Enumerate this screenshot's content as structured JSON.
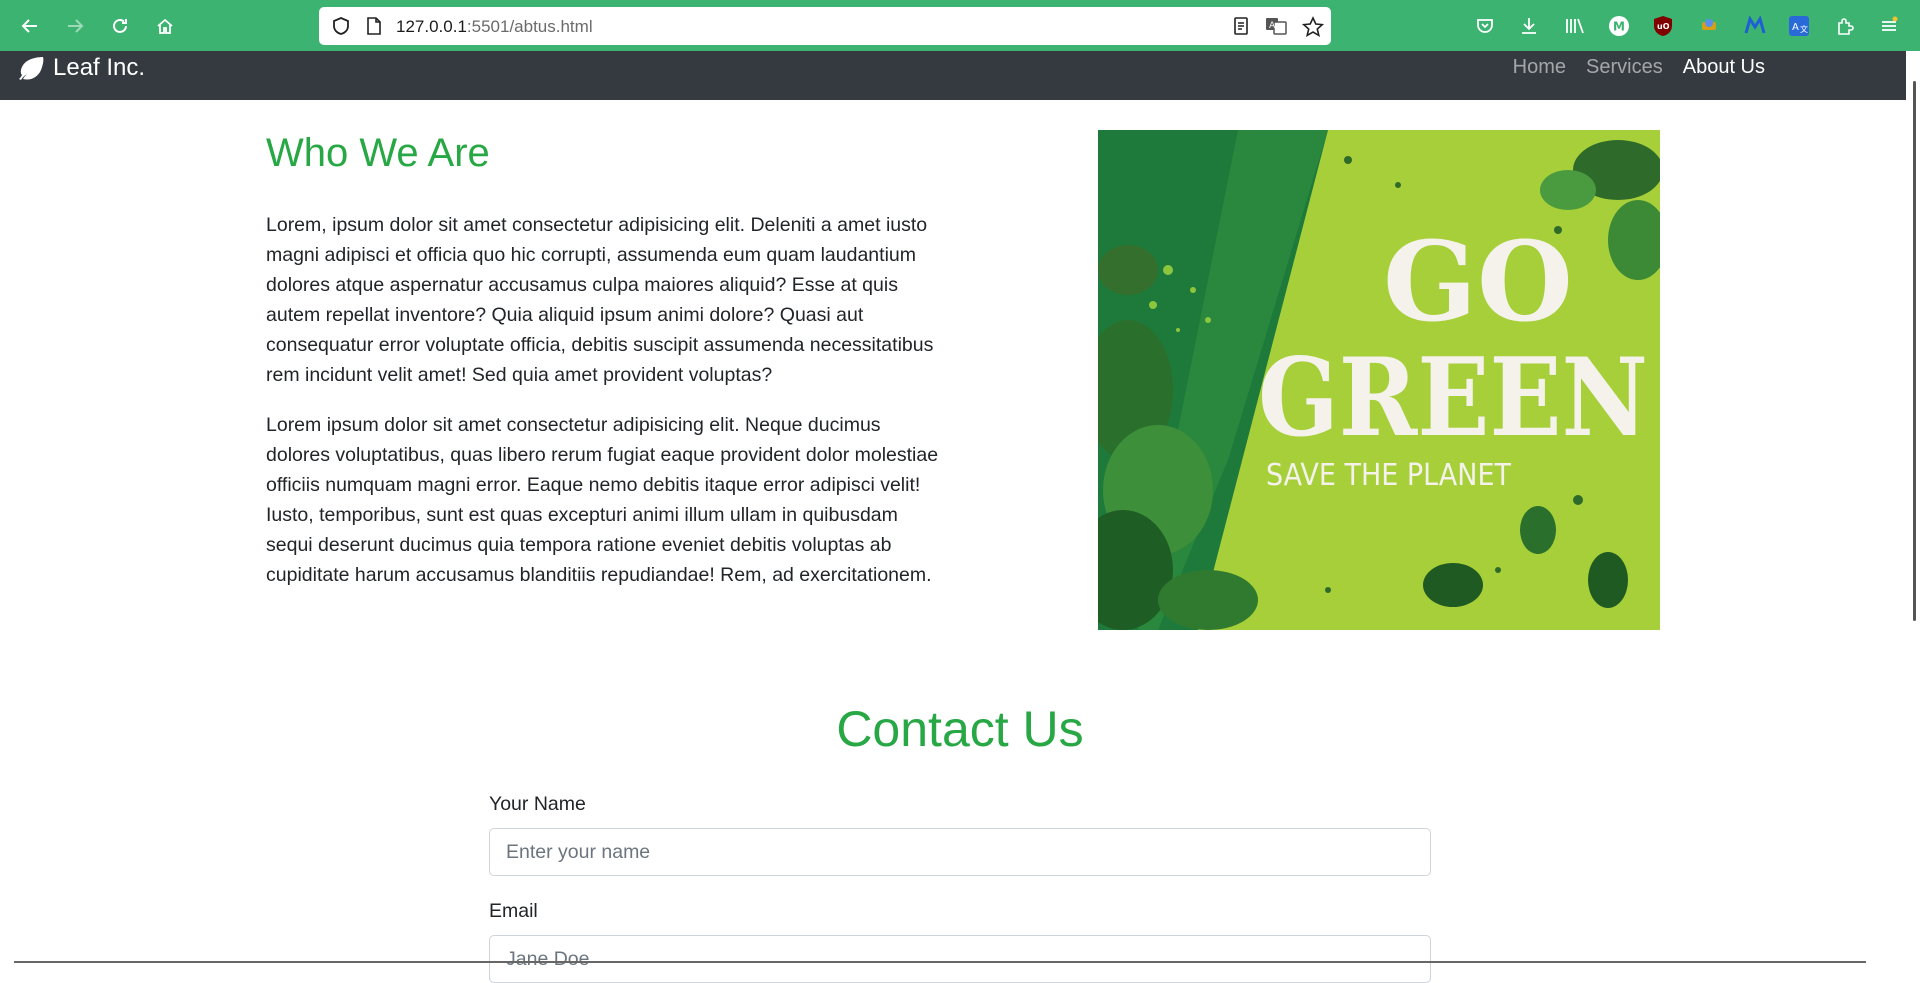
{
  "browser": {
    "url_host": "127.0.0.1",
    "url_rest": ":5501/abtus.html",
    "accent_color": "#3cb371",
    "icons": [
      "back-icon",
      "forward-icon",
      "reload-icon",
      "home-icon",
      "shield-icon",
      "page-icon",
      "reader-view-icon",
      "translate-icon",
      "bookmark-star-icon",
      "pocket-icon",
      "download-icon",
      "library-icon",
      "m-extension-icon",
      "ublock-icon",
      "extension-icon",
      "malwarebytes-icon",
      "translator-icon",
      "extensions-icon",
      "menu-icon"
    ]
  },
  "navbar": {
    "brand": "Leaf Inc.",
    "links": [
      {
        "label": "Home",
        "active": false
      },
      {
        "label": "Services",
        "active": false
      },
      {
        "label": "About Us",
        "active": true
      }
    ]
  },
  "about": {
    "title": "Who We Are",
    "paragraphs": [
      "Lorem, ipsum dolor sit amet consectetur adipisicing elit. Deleniti a amet iusto magni adipisci et officia quo hic corrupti, assumenda eum quam laudantium dolores atque aspernatur accusamus culpa maiores aliquid? Esse at quis autem repellat inventore? Quia aliquid ipsum animi dolore? Quasi aut consequatur error voluptate officia, debitis suscipit assumenda necessitatibus rem incidunt velit amet! Sed quia amet provident voluptas?",
      "Lorem ipsum dolor sit amet consectetur adipisicing elit. Neque ducimus dolores voluptatibus, quas libero rerum fugiat eaque provident dolor molestiae officiis numquam magni error. Eaque nemo debitis itaque error adipisci velit! Iusto, temporibus, sunt est quas excepturi animi illum ullam in quibusdam sequi deserunt ducimus quia tempora ratione eveniet debitis voluptas ab cupiditate harum accusamus blanditiis repudiandae! Rem, ad exercitationem."
    ],
    "image": {
      "line1": "GO",
      "line2": "GREEN",
      "line3": "SAVE THE PLANET"
    }
  },
  "contact": {
    "title": "Contact Us",
    "name_label": "Your Name",
    "name_placeholder": "Enter your name",
    "email_label": "Email",
    "email_placeholder": "Jane Doe"
  },
  "colors": {
    "accent_green": "#28a745",
    "navbar_bg": "#343a40"
  }
}
